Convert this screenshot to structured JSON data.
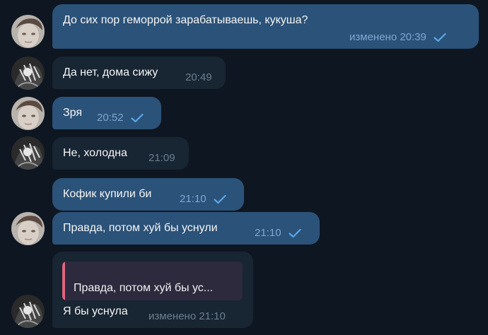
{
  "theme": {
    "background": "#0e1621",
    "outgoing_bubble": "#2b5278",
    "incoming_bubble": "#182533",
    "reply_accent": "#e0637c",
    "meta_out": "#7da8d3",
    "meta_in": "#6d7f8f"
  },
  "messages": [
    {
      "text": "До сих пор геморрой зарабатываешь, кукуша?",
      "meta": "изменено 20:39",
      "direction": "outgoing",
      "read": true,
      "avatar": "avatar-face"
    },
    {
      "text": "Да нет, дома сижу",
      "meta": "20:49",
      "direction": "incoming",
      "read": false,
      "avatar": "avatar-dark"
    },
    {
      "text": "Зря",
      "meta": "20:52",
      "direction": "outgoing",
      "read": true,
      "avatar": "avatar-face"
    },
    {
      "text": "Не, холодна",
      "meta": "21:09",
      "direction": "incoming",
      "read": false,
      "avatar": "avatar-dark"
    },
    {
      "text": "Кофик купили би",
      "meta": "21:10",
      "direction": "outgoing",
      "read": true,
      "avatar": null
    },
    {
      "text": "Правда, потом хуй бы уснули",
      "meta": "21:10",
      "direction": "outgoing",
      "read": true,
      "avatar": "avatar-face"
    },
    {
      "text": "Я бы уснула",
      "meta": "изменено 21:10",
      "direction": "incoming",
      "read": false,
      "avatar": "avatar-dark",
      "reply_to": "Правда, потом хуй бы ус..."
    }
  ]
}
